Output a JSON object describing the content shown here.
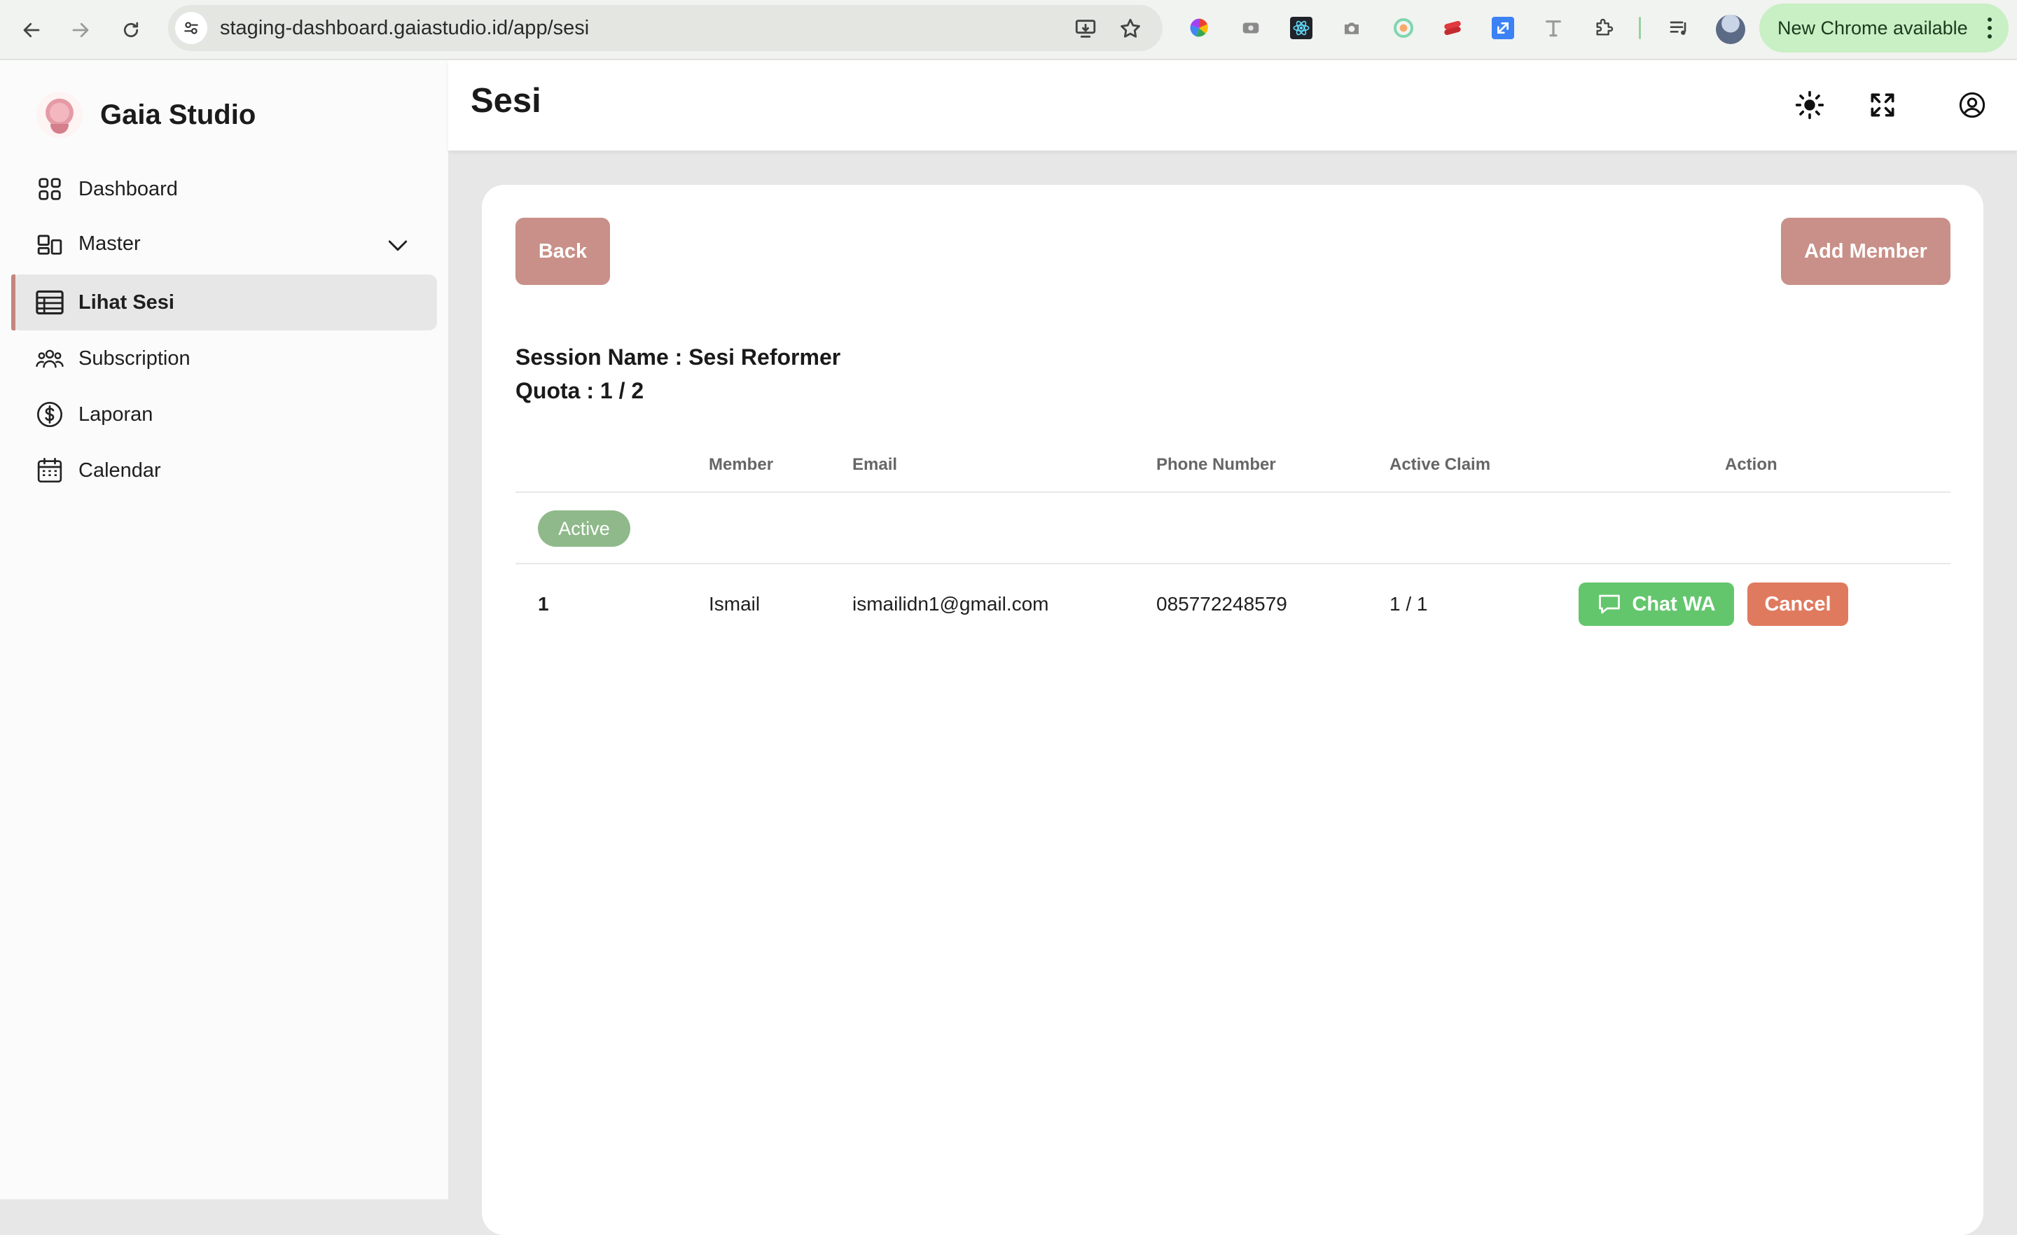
{
  "browser": {
    "url": "staging-dashboard.gaiastudio.id/app/sesi",
    "update_label": "New Chrome available"
  },
  "sidebar": {
    "brand": "Gaia Studio",
    "items": [
      {
        "label": "Dashboard",
        "icon": "grid-icon"
      },
      {
        "label": "Master",
        "icon": "layout-icon",
        "expandable": true
      },
      {
        "label": "Lihat Sesi",
        "icon": "table-icon",
        "active": true
      },
      {
        "label": "Subscription",
        "icon": "users-icon"
      },
      {
        "label": "Laporan",
        "icon": "dollar-icon"
      },
      {
        "label": "Calendar",
        "icon": "calendar-icon"
      }
    ]
  },
  "header": {
    "title": "Sesi",
    "icons": [
      "sun-icon",
      "fullscreen-icon",
      "user-icon"
    ]
  },
  "main": {
    "back_label": "Back",
    "add_member_label": "Add Member",
    "session_name": "Session Name : Sesi Reformer",
    "quota": "Quota : 1 / 2",
    "table": {
      "headers": [
        "",
        "Member",
        "Email",
        "Phone Number",
        "Active Claim",
        "Action"
      ],
      "group_label": "Active",
      "rows": [
        {
          "no": "1",
          "member": "Ismail",
          "email": "ismailidn1@gmail.com",
          "phone": "085772248579",
          "active_claim": "1 / 1"
        }
      ],
      "chat_label": "Chat WA",
      "cancel_label": "Cancel"
    }
  },
  "colors": {
    "accent": "#c89088",
    "active_badge": "#8fb98a",
    "chat_button": "#63c66d",
    "cancel_button": "#df7a5e"
  }
}
